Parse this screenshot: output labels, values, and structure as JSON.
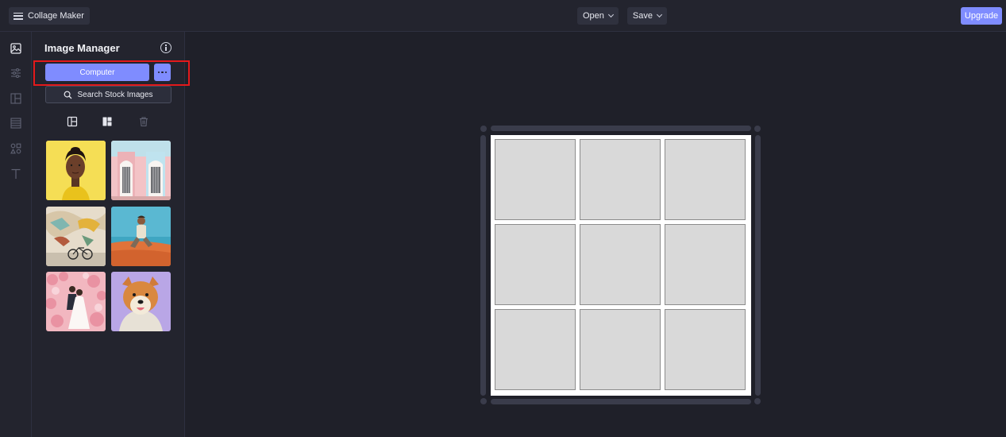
{
  "header": {
    "app_title": "Collage Maker",
    "open_label": "Open",
    "save_label": "Save",
    "upgrade_label": "Upgrade"
  },
  "rail": {
    "icons": [
      "image-icon",
      "adjustments-icon",
      "layout-icon",
      "background-icon",
      "shapes-icon",
      "text-icon"
    ]
  },
  "panel": {
    "title": "Image Manager",
    "computer_label": "Computer",
    "search_stock_label": "Search Stock Images",
    "thumbnails": [
      "woman-yellow-portrait",
      "pink-building-doors",
      "mural-bicycle",
      "man-sitting-beach",
      "couple-pink-blossoms",
      "shiba-dog"
    ]
  },
  "canvas": {
    "grid_rows": 3,
    "grid_cols": 3
  },
  "colors": {
    "accent": "#7f8cff",
    "background": "#1f2029",
    "highlight": "#e3191b"
  }
}
